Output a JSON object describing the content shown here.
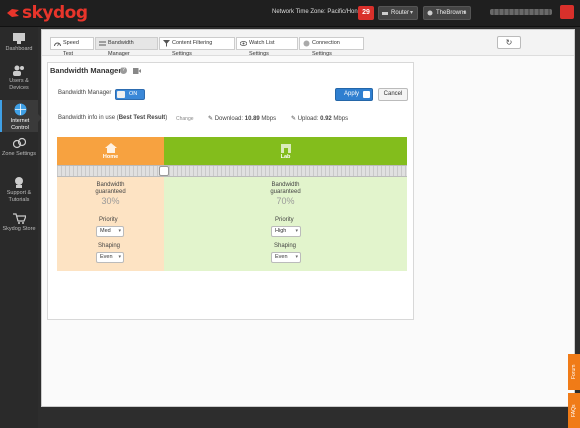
{
  "brand": {
    "name": "skydog",
    "color": "#e8352b"
  },
  "header": {
    "timezone_label": "Network Time Zone: Pacific/Honolulu",
    "alert_count": "29",
    "router_label": "Router",
    "network_label": "TheBrowns"
  },
  "sidebar": {
    "items": [
      {
        "label": "Dashboard",
        "icon": "dashboard-icon"
      },
      {
        "label": "Users & Devices",
        "icon": "users-icon"
      },
      {
        "label": "Internet Control",
        "icon": "globe-icon",
        "active": true
      },
      {
        "label": "Zone Settings",
        "icon": "zones-icon"
      },
      {
        "label": "Support & Tutorials",
        "icon": "support-icon"
      },
      {
        "label": "Skydog Store",
        "icon": "cart-icon"
      }
    ]
  },
  "tabs": [
    {
      "label": "Speed Test",
      "icon": "speedometer-icon"
    },
    {
      "label": "Bandwidth Manager",
      "icon": "bandwidth-icon",
      "active": true
    },
    {
      "label": "Content Filtering Settings",
      "icon": "filter-icon"
    },
    {
      "label": "Watch List Settings",
      "icon": "eye-icon"
    },
    {
      "label": "Connection Settings",
      "icon": "connection-icon"
    }
  ],
  "page": {
    "title": "Bandwidth Manager",
    "bm_label": "Bandwidth Manager",
    "toggle_state": "ON",
    "apply_label": "Apply",
    "cancel_label": "Cancel",
    "info_prefix": "Bandwidth info in use (",
    "info_source": "Best Test Result",
    "info_suffix": ")",
    "change_label": "Change",
    "download_label": "Download:",
    "download_value": "10.89",
    "download_unit": "Mbps",
    "upload_label": "Upload:",
    "upload_value": "0.92",
    "upload_unit": "Mbps"
  },
  "zones": [
    {
      "name": "Home",
      "color": "#f7a240",
      "bg": "#fde3c3",
      "bandwidth_label": "Bandwidth guaranteed",
      "percent": "30%",
      "priority_label": "Priority",
      "priority": "Med",
      "shaping_label": "Shaping",
      "shaping": "Even"
    },
    {
      "name": "Lab",
      "color": "#83bd1c",
      "bg": "#e2f4cc",
      "bandwidth_label": "Bandwidth guaranteed",
      "percent": "70%",
      "priority_label": "Priority",
      "priority": "High",
      "shaping_label": "Shaping",
      "shaping": "Even"
    }
  ],
  "allocation_split": 0.3,
  "side_tabs": [
    "Forum",
    "FAQs"
  ],
  "accent": "#3a88d8"
}
